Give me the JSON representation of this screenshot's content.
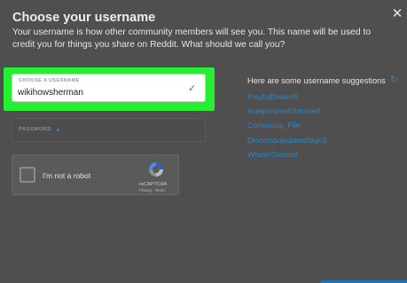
{
  "header": {
    "title": "Choose your username",
    "description": "Your username is how other community members will see you. This name will be used to credit you for things you share on Reddit. What should we call you?",
    "close_icon": "close-icon"
  },
  "form": {
    "username": {
      "label": "CHOOSE A USERNAME",
      "value": "wikihowsherman",
      "status_icon": "checkmark-icon"
    },
    "password": {
      "label": "PASSWORD"
    },
    "highlight_color": "#26ee32"
  },
  "captcha": {
    "checkbox_label": "I'm not a robot",
    "brand": "reCAPTCHA",
    "privacy": "Privacy",
    "separator": " - ",
    "terms": "Terms"
  },
  "suggestions": {
    "title": "Here are some username suggestions",
    "refresh_icon": "refresh-icon",
    "items": [
      {
        "label": "PlayfulDream9"
      },
      {
        "label": "IndependentVolome4"
      },
      {
        "label": "Conscious_File"
      },
      {
        "label": "DiscombobulatedSign3"
      },
      {
        "label": "WholeChemist"
      }
    ]
  },
  "colors": {
    "accent": "#2d86c9",
    "modal_background": "#4f4f4f"
  }
}
